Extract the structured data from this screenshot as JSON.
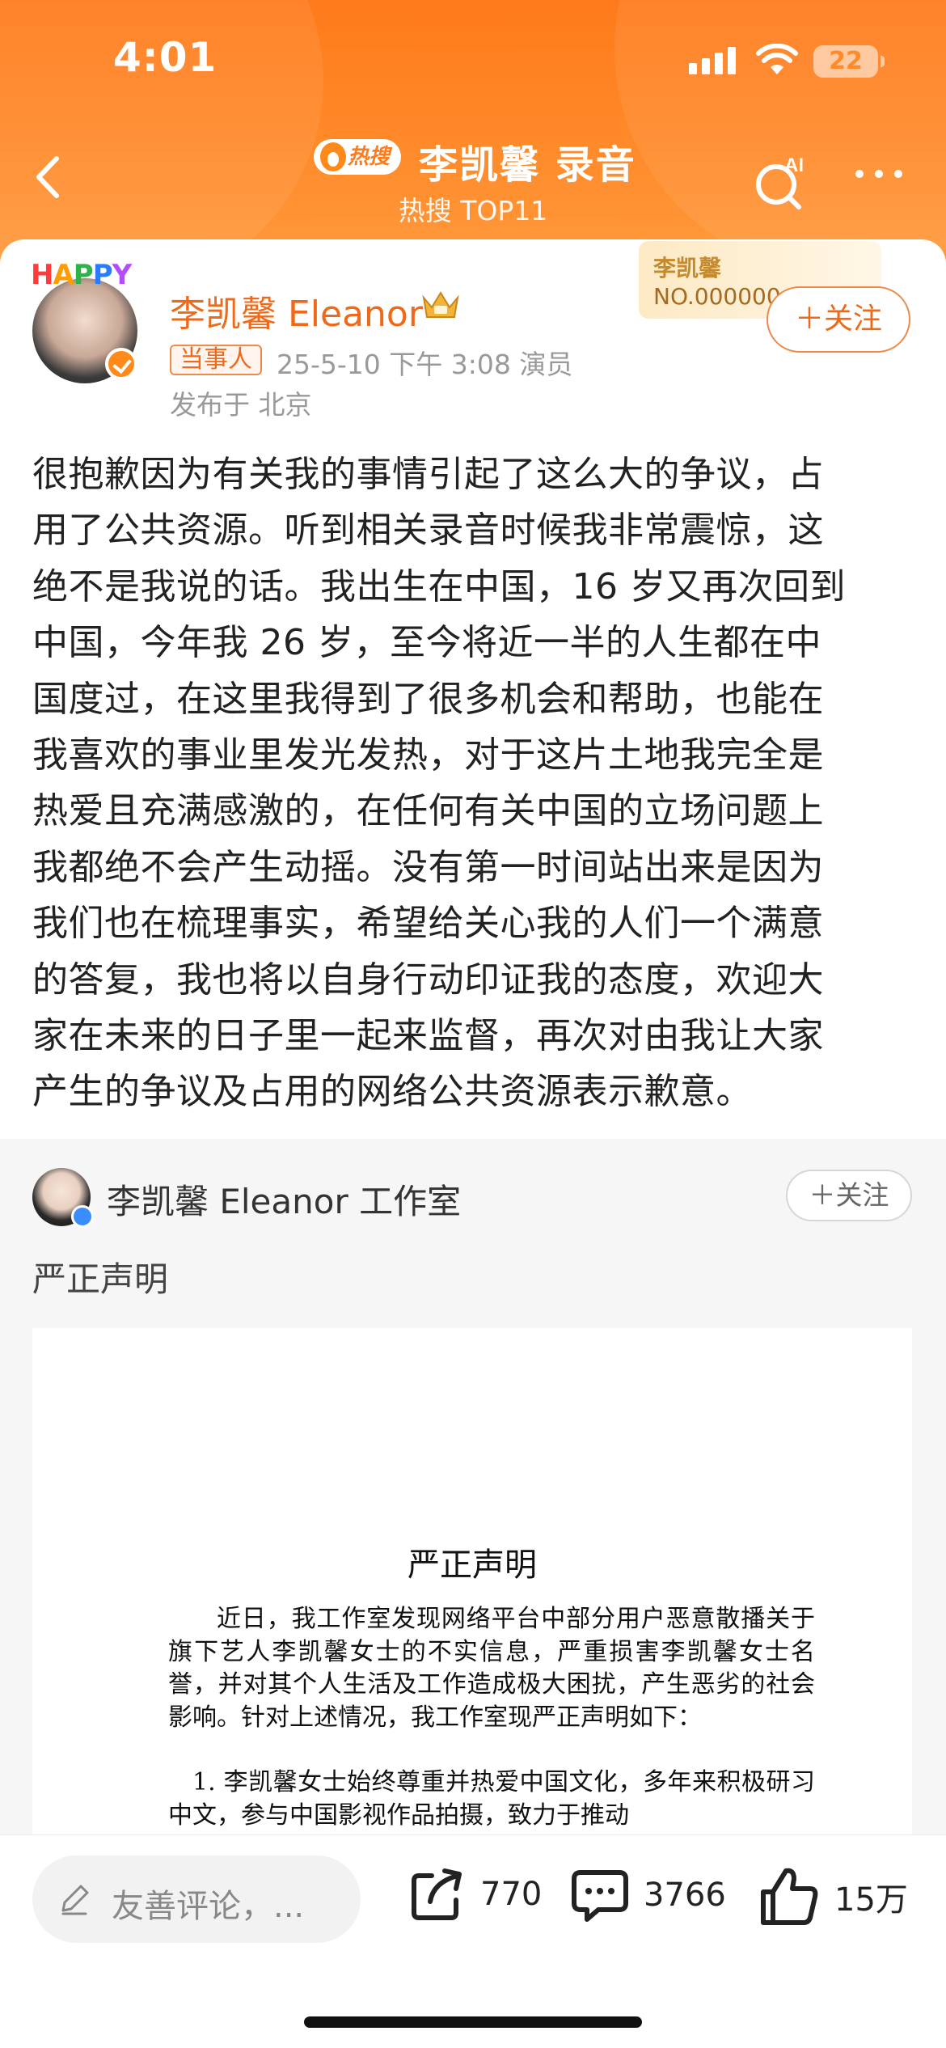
{
  "status_bar": {
    "time": "4:01",
    "battery": "22"
  },
  "nav": {
    "hot_badge": "热搜",
    "title": "李凯馨 录音",
    "subtitle": "热搜 TOP11"
  },
  "post": {
    "avatar_deco": [
      "H",
      "A",
      "P",
      "P",
      "Y"
    ],
    "author": "李凯馨 Eleanor",
    "tag": "当事人",
    "meta": "25-5-10 下午 3:08  演员",
    "location": "发布于 北京",
    "fan_card_name": "李凯馨",
    "fan_card_no": "NO.000000",
    "follow_label": "＋关注",
    "lines": [
      "很抱歉因为有关我的事情引起了这么大的争议，占",
      "用了公共资源。听到相关录音时候我非常震惊，这",
      "绝不是我说的话。我出生在中国，16 岁又再次回到",
      "中国，今年我 26 岁，至今将近一半的人生都在中",
      "国度过，在这里我得到了很多机会和帮助，也能在",
      "我喜欢的事业里发光发热，对于这片土地我完全是",
      "热爱且充满感激的，在任何有关中国的立场问题上",
      "我都绝不会产生动摇。没有第一时间站出来是因为",
      "我们也在梳理事实，希望给关心我的人们一个满意",
      "的答复，我也将以自身行动印证我的态度，欢迎大",
      "家在未来的日子里一起来监督，再次对由我让大家",
      "产生的争议及占用的网络公共资源表示歉意。"
    ]
  },
  "repost": {
    "name": "李凯馨 Eleanor 工作室",
    "follow_label": "＋关注",
    "text": "严正声明",
    "doc_title": "严正声明",
    "doc_para1": "近日，我工作室发现网络平台中部分用户恶意散播关于旗下艺人李凯馨女士的不实信息，严重损害李凯馨女士名誉，并对其个人生活及工作造成极大困扰，产生恶劣的社会影响。针对上述情况，我工作室现严正声明如下：",
    "doc_para2": "1. 李凯馨女士始终尊重并热爱中国文化，多年来积极研习中文，参与中国影视作品拍摄，致力于推动"
  },
  "bottom_bar": {
    "comment_placeholder": "友善评论，...",
    "repost_count": "770",
    "comment_count": "3766",
    "like_count": "15万"
  },
  "colors": {
    "accent": "#ff7a1a",
    "author": "#ee6a1a"
  },
  "icons": [
    "back-arrow-icon",
    "hot-flame-icon",
    "ai-search-icon",
    "more-icon",
    "crown-icon",
    "verified-icon",
    "pen-icon",
    "share-icon",
    "comment-icon",
    "like-icon",
    "signal-icon",
    "wifi-icon",
    "battery-icon"
  ]
}
